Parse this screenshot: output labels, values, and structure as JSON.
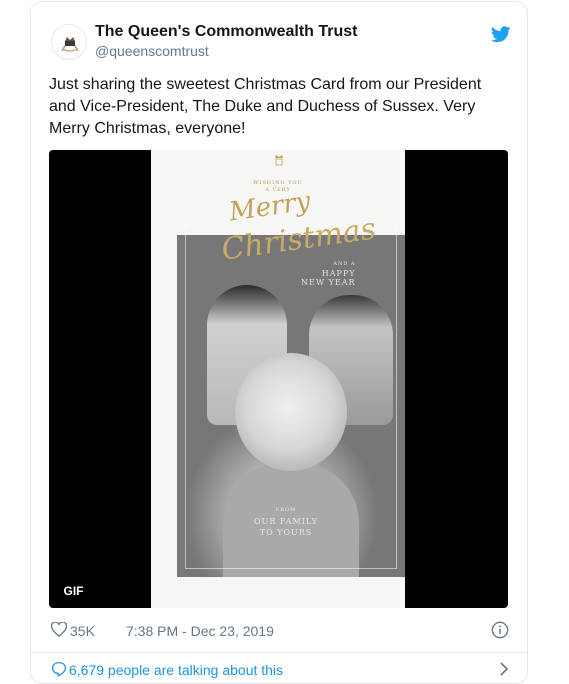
{
  "account": {
    "display_name": "The Queen's Commonwealth Trust",
    "handle": "@queenscomtrust"
  },
  "tweet": {
    "text": "Just sharing the sweetest Christmas Card from our President and Vice-President, The Duke and Duchess of Sussex. Very Merry Christmas, everyone!"
  },
  "media": {
    "badge": "GIF",
    "card": {
      "wishing": "WISHING YOU",
      "a_very": "A VERY",
      "merry": "Merry",
      "christmas": "Christmas",
      "and_a": "AND A",
      "happy": "HAPPY",
      "new_year": "NEW YEAR",
      "from": "FROM",
      "our_family": "OUR FAMILY",
      "to_yours": "TO YOURS"
    }
  },
  "meta": {
    "likes": "35K",
    "timestamp": "7:38 PM - Dec 23, 2019"
  },
  "conversation": {
    "text": "6,679 people are talking about this"
  },
  "colors": {
    "twitter_blue": "#1da1f2",
    "link_blue": "#1b95e0",
    "secondary_text": "#657786",
    "gold": "#c2a15a"
  },
  "icons": [
    "crest-icon",
    "twitter-bird-icon",
    "heart-icon",
    "info-icon",
    "speech-bubble-icon",
    "chevron-right-icon"
  ]
}
